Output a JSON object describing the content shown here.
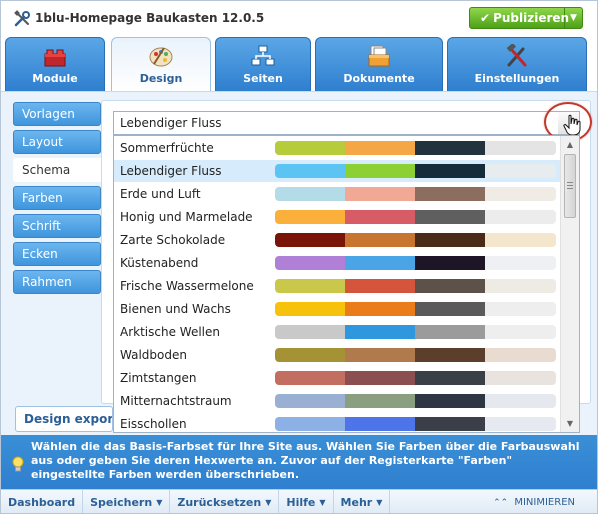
{
  "app": {
    "title": "1blu-Homepage Baukasten 12.0.5",
    "publish_label": "Publizieren",
    "colors": {
      "accent": "#2f7fcf",
      "publish": "#5bb022"
    }
  },
  "tabs": [
    {
      "label": "Module",
      "icon": "module-blocks-icon"
    },
    {
      "label": "Design",
      "icon": "palette-icon"
    },
    {
      "label": "Seiten",
      "icon": "sitemap-icon"
    },
    {
      "label": "Dokumente",
      "icon": "documents-box-icon"
    },
    {
      "label": "Einstellungen",
      "icon": "tools-icon"
    }
  ],
  "sidebar": {
    "items": [
      {
        "label": "Vorlagen"
      },
      {
        "label": "Layout"
      },
      {
        "label": "Schema"
      },
      {
        "label": "Farben"
      },
      {
        "label": "Schrift"
      },
      {
        "label": "Ecken"
      },
      {
        "label": "Rahmen"
      }
    ]
  },
  "schema": {
    "selected": "Lebendiger Fluss",
    "export_label": "Design exportieren"
  },
  "palettes": [
    {
      "name": "Sommerfrüchte",
      "colors": [
        "#b6cc3a",
        "#f5a745",
        "#22333d",
        "#e4e4e4"
      ]
    },
    {
      "name": "Lebendiger Fluss",
      "colors": [
        "#5bc4f3",
        "#8bd133",
        "#152c3a",
        "#e7ecef"
      ]
    },
    {
      "name": "Erde und Luft",
      "colors": [
        "#b3dce8",
        "#f1a894",
        "#8c6e60",
        "#f1ebe5"
      ]
    },
    {
      "name": "Honig und Marmelade",
      "colors": [
        "#fbb03b",
        "#d85c66",
        "#5f5f5f",
        "#ececec"
      ]
    },
    {
      "name": "Zarte Schokolade",
      "colors": [
        "#7a1409",
        "#c8762f",
        "#4a2b17",
        "#f3e6cc"
      ]
    },
    {
      "name": "Küstenabend",
      "colors": [
        "#b07fd6",
        "#4aa4e6",
        "#1e1527",
        "#eef0f4"
      ]
    },
    {
      "name": "Frische Wassermelone",
      "colors": [
        "#c9c84b",
        "#d4543c",
        "#5c5249",
        "#eeeae4"
      ]
    },
    {
      "name": "Bienen und Wachs",
      "colors": [
        "#f7c20b",
        "#eb7c1a",
        "#5a5a5a",
        "#eeeeee"
      ]
    },
    {
      "name": "Arktische Wellen",
      "colors": [
        "#c9c9c9",
        "#2f97de",
        "#9b9b9b",
        "#eeeeee"
      ]
    },
    {
      "name": "Waldboden",
      "colors": [
        "#a59234",
        "#b07a4c",
        "#5b3f2b",
        "#eadbd0"
      ]
    },
    {
      "name": "Zimtstangen",
      "colors": [
        "#c26e60",
        "#8b4f4f",
        "#3b3f46",
        "#e9e3e0"
      ]
    },
    {
      "name": "Mitternachtstraum",
      "colors": [
        "#9ab0d3",
        "#8a9e80",
        "#2e3644",
        "#e5e8ef"
      ]
    },
    {
      "name": "Eisschollen",
      "colors": [
        "#8db0e6",
        "#4d74e8",
        "#3a3f4a",
        "#e6e9f0"
      ]
    }
  ],
  "info": {
    "text": "Wählen die das Basis-Farbset für Ihre Site aus. Wählen Sie Farben über die Farbauswahl aus oder geben Sie deren Hexwerte an. Zuvor auf der Registerkarte \"Farben\" eingestellte Farben werden überschrieben."
  },
  "bottom": {
    "items": [
      {
        "label": "Dashboard",
        "has_caret": false
      },
      {
        "label": "Speichern",
        "has_caret": true
      },
      {
        "label": "Zurücksetzen",
        "has_caret": true
      },
      {
        "label": "Hilfe",
        "has_caret": true
      },
      {
        "label": "Mehr",
        "has_caret": true
      }
    ],
    "minimize_label": "MINIMIEREN"
  }
}
